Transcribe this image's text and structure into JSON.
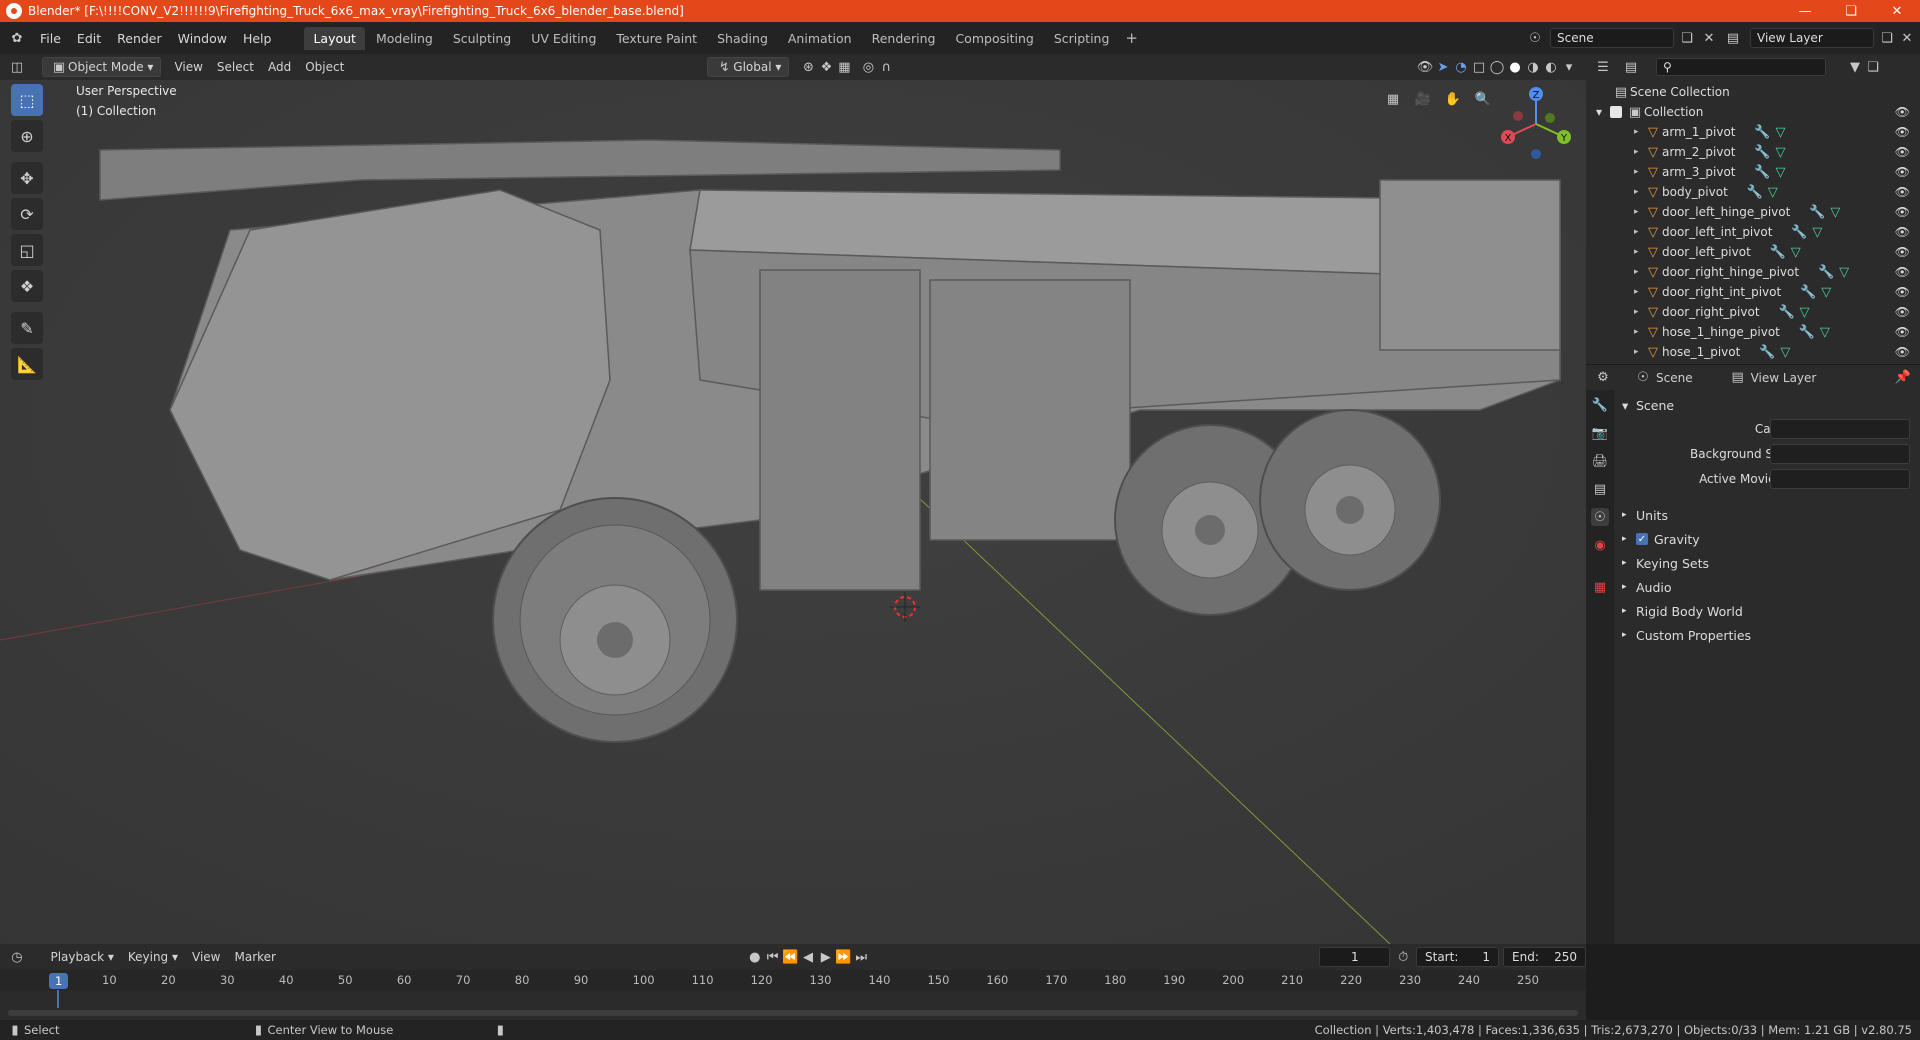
{
  "title": "Blender* [F:\\!!!!CONV_V2!!!!!!9\\Firefighting_Truck_6x6_max_vray\\Firefighting_Truck_6x6_blender_base.blend]",
  "menus": [
    "File",
    "Edit",
    "Render",
    "Window",
    "Help"
  ],
  "workspaces": [
    "Layout",
    "Modeling",
    "Sculpting",
    "UV Editing",
    "Texture Paint",
    "Shading",
    "Animation",
    "Rendering",
    "Compositing",
    "Scripting"
  ],
  "active_workspace": "Layout",
  "scene_field": "Scene",
  "view_layer_field": "View Layer",
  "header": {
    "mode": "Object Mode",
    "menus": [
      "View",
      "Select",
      "Add",
      "Object"
    ],
    "transform": "Global"
  },
  "viewport": {
    "perspective": "User Perspective",
    "collection": "(1) Collection"
  },
  "gizmo": {
    "x": "X",
    "y": "Y",
    "z": "Z"
  },
  "outliner": {
    "root": "Scene Collection",
    "collection": "Collection",
    "items": [
      "arm_1_pivot",
      "arm_2_pivot",
      "arm_3_pivot",
      "body_pivot",
      "door_left_hinge_pivot",
      "door_left_int_pivot",
      "door_left_pivot",
      "door_right_hinge_pivot",
      "door_right_int_pivot",
      "door_right_pivot",
      "hose_1_hinge_pivot",
      "hose_1_pivot"
    ]
  },
  "properties": {
    "tab_scene": "Scene",
    "tab_view_layer": "View Layer",
    "section": "Scene",
    "camera_label": "Camera",
    "bg_scene_label": "Background Scene",
    "movie_clip_label": "Active Movie Clip",
    "panels": [
      "Units",
      "Gravity",
      "Keying Sets",
      "Audio",
      "Rigid Body World",
      "Custom Properties"
    ]
  },
  "timeline": {
    "menus": [
      "Playback",
      "Keying",
      "View",
      "Marker"
    ],
    "current_frame": "1",
    "start_label": "Start:",
    "start": "1",
    "end_label": "End:",
    "end": "250",
    "ticks": [
      "1",
      "10",
      "20",
      "30",
      "40",
      "50",
      "60",
      "70",
      "80",
      "90",
      "100",
      "110",
      "120",
      "130",
      "140",
      "150",
      "160",
      "170",
      "180",
      "190",
      "200",
      "210",
      "220",
      "230",
      "240",
      "250"
    ]
  },
  "status": {
    "select": "Select",
    "center": "Center View to Mouse",
    "stats": "Collection | Verts:1,403,478 | Faces:1,336,635 | Tris:2,673,270 | Objects:0/33 | Mem: 1.21 GB | v2.80.75"
  },
  "colors": {
    "title_bar": "#e4471a",
    "accent": "#4772b3",
    "orange_icon": "#e8913b",
    "green_icon": "#4ecf9a"
  }
}
